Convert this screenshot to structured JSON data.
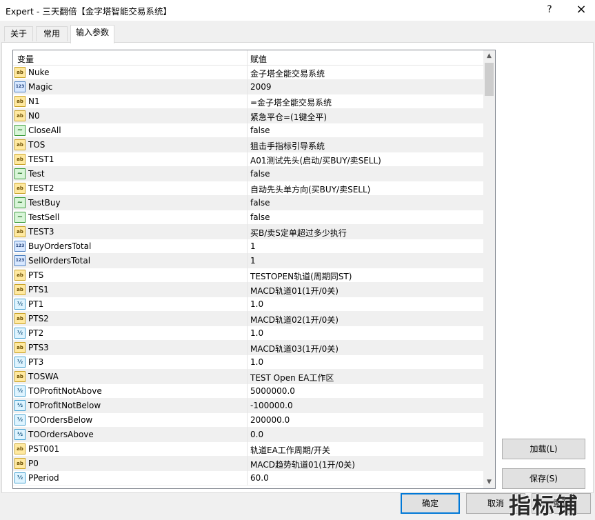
{
  "window": {
    "title": "Expert - 三天翻倍【金字塔智能交易系统】",
    "help": "?",
    "close": "×"
  },
  "tabs": [
    {
      "label": "关于"
    },
    {
      "label": "常用"
    },
    {
      "label": "输入参数"
    }
  ],
  "grid": {
    "headers": {
      "variable": "变量",
      "value": "赋值"
    },
    "rows": [
      {
        "type": "string",
        "icon": "ab",
        "name": "Nuke",
        "value": "金子塔全能交易系统"
      },
      {
        "type": "int",
        "icon": "123",
        "name": "Magic",
        "value": "2009"
      },
      {
        "type": "string",
        "icon": "ab",
        "name": "N1",
        "value": "=金子塔全能交易系统"
      },
      {
        "type": "string",
        "icon": "ab",
        "name": "N0",
        "value": "紧急平仓=(1键全平)"
      },
      {
        "type": "bool",
        "icon": "~",
        "name": "CloseAll",
        "value": "false"
      },
      {
        "type": "string",
        "icon": "ab",
        "name": "TOS",
        "value": "狙击手指标引导系统"
      },
      {
        "type": "string",
        "icon": "ab",
        "name": "TEST1",
        "value": "A01测试先头(启动/买BUY/卖SELL)"
      },
      {
        "type": "bool",
        "icon": "~",
        "name": "Test",
        "value": "false"
      },
      {
        "type": "string",
        "icon": "ab",
        "name": "TEST2",
        "value": "自动先头单方向(买BUY/卖SELL)"
      },
      {
        "type": "bool",
        "icon": "~",
        "name": "TestBuy",
        "value": "false"
      },
      {
        "type": "bool",
        "icon": "~",
        "name": "TestSell",
        "value": "false"
      },
      {
        "type": "string",
        "icon": "ab",
        "name": "TEST3",
        "value": "买B/卖S定单超过多少执行"
      },
      {
        "type": "int",
        "icon": "123",
        "name": "BuyOrdersTotal",
        "value": "1"
      },
      {
        "type": "int",
        "icon": "123",
        "name": "SellOrdersTotal",
        "value": "1"
      },
      {
        "type": "string",
        "icon": "ab",
        "name": "PTS",
        "value": "TESTOPEN轨道(周期同ST)"
      },
      {
        "type": "string",
        "icon": "ab",
        "name": "PTS1",
        "value": "MACD轨道01(1开/0关)"
      },
      {
        "type": "double",
        "icon": "½",
        "name": "PT1",
        "value": "1.0"
      },
      {
        "type": "string",
        "icon": "ab",
        "name": "PTS2",
        "value": "MACD轨道02(1开/0关)"
      },
      {
        "type": "double",
        "icon": "½",
        "name": "PT2",
        "value": "1.0"
      },
      {
        "type": "string",
        "icon": "ab",
        "name": "PTS3",
        "value": "MACD轨道03(1开/0关)"
      },
      {
        "type": "double",
        "icon": "½",
        "name": "PT3",
        "value": "1.0"
      },
      {
        "type": "string",
        "icon": "ab",
        "name": "TOSWA",
        "value": "TEST Open EA工作区"
      },
      {
        "type": "double",
        "icon": "½",
        "name": "TOProfitNotAbove",
        "value": "5000000.0"
      },
      {
        "type": "double",
        "icon": "½",
        "name": "TOProfitNotBelow",
        "value": "-100000.0"
      },
      {
        "type": "double",
        "icon": "½",
        "name": "TOOrdersBelow",
        "value": "200000.0"
      },
      {
        "type": "double",
        "icon": "½",
        "name": "TOOrdersAbove",
        "value": "0.0"
      },
      {
        "type": "string",
        "icon": "ab",
        "name": "PST001",
        "value": "轨道EA工作周期/开关"
      },
      {
        "type": "string",
        "icon": "ab",
        "name": "P0",
        "value": "MACD趋势轨道01(1开/0关)"
      },
      {
        "type": "double",
        "icon": "½",
        "name": "PPeriod",
        "value": "60.0"
      }
    ]
  },
  "scrollbar": {
    "up": "▲",
    "down": "▼"
  },
  "buttons": {
    "load": "加载(L)",
    "save": "保存(S)",
    "ok": "确定",
    "cancel": "取消",
    "reset": "重置"
  },
  "watermark": "指标铺"
}
